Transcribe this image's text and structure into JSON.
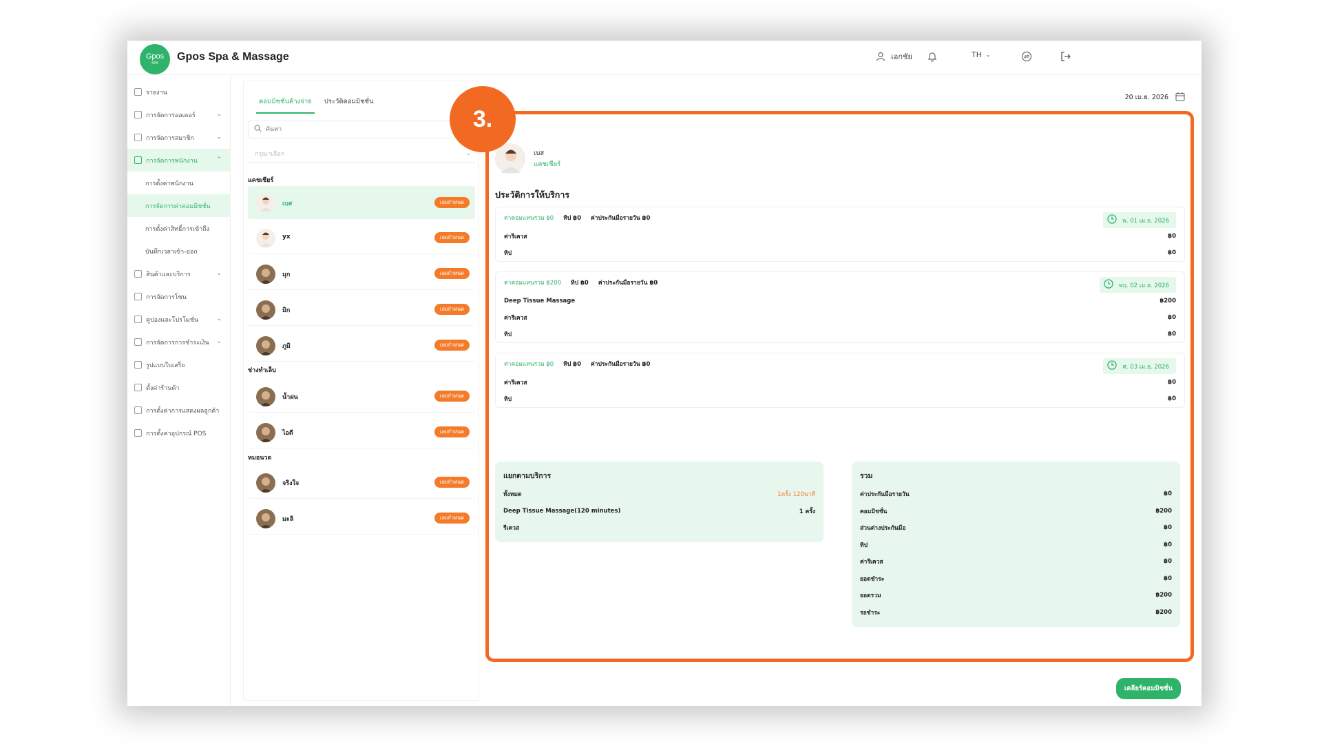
{
  "app": {
    "title": "Gpos Spa & Massage",
    "logo_main": "Gpos",
    "logo_sub": "SPA"
  },
  "header": {
    "user": "เอกชัย",
    "language": "TH"
  },
  "sidebar": {
    "items": [
      {
        "label": "รายงาน",
        "icon": "report-icon"
      },
      {
        "label": "การจัดการออเดอร์",
        "icon": "order-icon"
      },
      {
        "label": "การจัดการสมาชิก",
        "icon": "member-icon"
      },
      {
        "label": "การจัดการพนักงาน",
        "icon": "staff-icon"
      },
      {
        "label": "สินค้าและบริการ",
        "icon": "product-icon"
      },
      {
        "label": "การจัดการโซน",
        "icon": "zone-icon"
      },
      {
        "label": "คูปองและโปรโมชั่น",
        "icon": "coupon-icon"
      },
      {
        "label": "การจัดการการชำระเงิน",
        "icon": "payment-icon"
      },
      {
        "label": "รูปแบบใบเสร็จ",
        "icon": "receipt-icon"
      },
      {
        "label": "ตั้งค่าร้านค้า",
        "icon": "store-icon"
      },
      {
        "label": "การตั้งค่าการแสดงผลลูกค้า",
        "icon": "display-icon"
      },
      {
        "label": "การตั้งค่าอุปกรณ์ POS",
        "icon": "pos-icon"
      }
    ],
    "sub_items": [
      "การตั้งค่าพนักงาน",
      "การจัดการค่าคอมมิชชั่น",
      "การตั้งค่าสิทธิ์การเข้าถึง",
      "บันทึกเวลาเข้า-ออก"
    ]
  },
  "panel": {
    "tabs": [
      "คอมมิชชั่นค้างจ่าย",
      "ประวัติคอมมิชชั่น"
    ],
    "search_placeholder": "ค้นหา",
    "select_placeholder": "กรุณาเลือก",
    "groups": [
      {
        "label": "แคชเชียร์",
        "employees": [
          {
            "name": "เบส",
            "badge": "เลยกำหนด"
          },
          {
            "name": "yx",
            "badge": "เลยกำหนด"
          },
          {
            "name": "มุก",
            "badge": "เลยกำหนด"
          },
          {
            "name": "มิก",
            "badge": "เลยกำหนด"
          },
          {
            "name": "ภูมิ",
            "badge": "เลยกำหนด"
          }
        ]
      },
      {
        "label": "ช่างทำเล็บ",
        "employees": [
          {
            "name": "น้ำฝน",
            "badge": "เลยกำหนด"
          },
          {
            "name": "ไอดี",
            "badge": "เลยกำหนด"
          }
        ]
      },
      {
        "label": "หมอนวด",
        "employees": [
          {
            "name": "จริงใจ",
            "badge": "เลยกำหนด"
          },
          {
            "name": "มะลิ",
            "badge": "เลยกำหนด"
          }
        ]
      }
    ]
  },
  "main": {
    "date": "20 เม.ย. 2026",
    "profile_name": "เบส",
    "profile_role": "แคชเชียร์",
    "section_title": "ประวัติการให้บริการ",
    "step_label": "3.",
    "cards": [
      {
        "total": "ค่าคอมแทนรวม ฿0",
        "tip": "ทิป ฿0",
        "insurance": "ค่าประกันมือรายวัน ฿0",
        "date": "พ. 01 เม.ย. 2026",
        "rows": [
          {
            "label": "ค่ารีเควส",
            "value": "฿0"
          },
          {
            "label": "ทิป",
            "value": "฿0"
          }
        ]
      },
      {
        "total": "ค่าคอมแทนรวม ฿200",
        "tip": "ทิป ฿0",
        "insurance": "ค่าประกันมือรายวัน ฿0",
        "date": "พฤ. 02 เม.ย. 2026",
        "rows": [
          {
            "label": "Deep Tissue Massage",
            "value": "฿200"
          },
          {
            "label": "ค่ารีเควส",
            "value": "฿0"
          },
          {
            "label": "ทิป",
            "value": "฿0"
          }
        ]
      },
      {
        "total": "ค่าคอมแทนรวม ฿0",
        "tip": "ทิป ฿0",
        "insurance": "ค่าประกันมือรายวัน ฿0",
        "date": "ศ. 03 เม.ย. 2026",
        "rows": [
          {
            "label": "ค่ารีเควส",
            "value": "฿0"
          },
          {
            "label": "ทิป",
            "value": "฿0"
          }
        ]
      }
    ],
    "by_service": {
      "title": "แยกตามบริการ",
      "rows": [
        {
          "label": "ทั้งหมด",
          "value": "1ครั้ง 120นาที"
        },
        {
          "label": "Deep Tissue Massage(120 minutes)",
          "value": "1 ครั้ง"
        },
        {
          "label": "รีเควส",
          "value": ""
        }
      ]
    },
    "totals": {
      "title": "รวม",
      "rows": [
        {
          "label": "ค่าประกันมือรายวัน",
          "value": "฿0"
        },
        {
          "label": "คอมมิชชั่น",
          "value": "฿200"
        },
        {
          "label": "ส่วนต่างประกันมือ",
          "value": "฿0"
        },
        {
          "label": "ทิป",
          "value": "฿0"
        },
        {
          "label": "ค่ารีเควส",
          "value": "฿0"
        },
        {
          "label": "ยอดชำระ",
          "value": "฿0"
        },
        {
          "label": "ยอดรวม",
          "value": "฿200"
        },
        {
          "label": "รอชำระ",
          "value": "฿200"
        }
      ]
    },
    "clear_button": "เคลียร์คอมมิชชั่น"
  },
  "colors": {
    "accent": "#2fb36a",
    "orange": "#f26a22",
    "badge": "#f47b2a",
    "active_bg": "#e6f7ec"
  }
}
